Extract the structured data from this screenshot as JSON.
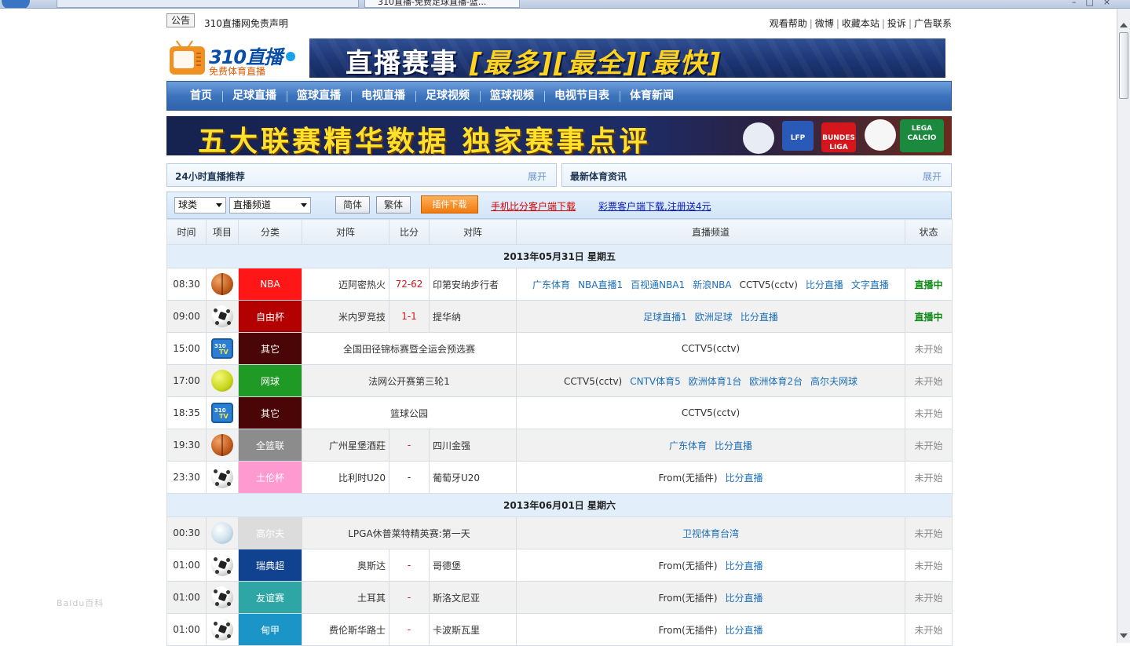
{
  "browser": {
    "tab_title": "310直播-免费足球直播-篮..."
  },
  "topbar": {
    "badge": "公告",
    "notice": "310直播网免责声明",
    "links": [
      "观看帮助",
      "微博",
      "收藏本站",
      "投诉",
      "广告联系"
    ]
  },
  "logo": {
    "title": "310直播",
    "subtitle": "免费体育直播"
  },
  "banner1": {
    "part1": "直播赛事",
    "part2": "[最多][最全][最快]"
  },
  "nav": {
    "items": [
      "首页",
      "足球直播",
      "篮球直播",
      "电视直播",
      "足球视频",
      "篮球视频",
      "电视节目表",
      "体育新闻"
    ]
  },
  "banner2": {
    "text": "五大联赛精华数据 独家赛事点评",
    "logos": [
      "LFP",
      "BUNDES LIGA",
      "LEGA CALCIO"
    ]
  },
  "panels": {
    "left_title": "24小时直播推荐",
    "left_more": "展开",
    "right_title": "最新体育资讯",
    "right_more": "展开"
  },
  "filters": {
    "sport_select": "球类",
    "channel_select": "直播频道",
    "btn_simplified": "简体",
    "btn_traditional": "繁体",
    "btn_plugin": "插件下载",
    "link_mobile": "手机比分客户端下载",
    "link_lottery": "彩票客户端下载,注册送4元"
  },
  "table": {
    "headers": [
      "时间",
      "项目",
      "分类",
      "对阵",
      "比分",
      "对阵",
      "直播频道",
      "状态"
    ],
    "date1": "2013年05月31日 星期五",
    "date2": "2013年06月01日 星期六",
    "colors": {
      "nba": "#ff1717",
      "freedom_cup": "#b30000",
      "other": "#4a0606",
      "tennis": "#1f9b25",
      "cba": "#8c8c8c",
      "toulon": "#ff9ad0",
      "golf": "#dcdcdc",
      "sweden": "#10428f",
      "friendly": "#2fa6a6",
      "portugal": "#1b95c8"
    },
    "rows_day1": [
      {
        "time": "08:30",
        "icon": "basketball-icon",
        "category": "NBA",
        "home": "迈阿密热火",
        "score": "72-62",
        "away": "印第安纳步行者",
        "match": "",
        "channels": [
          "广东体育",
          "NBA直播1",
          "百视通NBA1",
          "新浪NBA",
          "CCTV5(cctv)",
          "比分直播",
          "文字直播"
        ],
        "status": "直播中"
      },
      {
        "time": "09:00",
        "icon": "soccer-icon",
        "category": "自由杯",
        "home": "米内罗竞技",
        "score": "1-1",
        "away": "提华纳",
        "match": "",
        "channels": [
          "足球直播1",
          "欧洲足球",
          "比分直播"
        ],
        "status": "直播中"
      },
      {
        "time": "15:00",
        "icon": "tv-icon",
        "category": "其它",
        "home": "",
        "score": "",
        "away": "",
        "match": "全国田径锦标赛暨全运会预选赛",
        "channels": [
          "CCTV5(cctv)"
        ],
        "status": "未开始"
      },
      {
        "time": "17:00",
        "icon": "tennis-icon",
        "category": "网球",
        "home": "",
        "score": "",
        "away": "",
        "match": "法网公开赛第三轮1",
        "channels": [
          "CCTV5(cctv)",
          "CNTV体育5",
          "欧洲体育1台",
          "欧洲体育2台",
          "高尔夫网球"
        ],
        "status": "未开始"
      },
      {
        "time": "18:35",
        "icon": "tv-icon",
        "category": "其它",
        "home": "",
        "score": "",
        "away": "",
        "match": "篮球公园",
        "channels": [
          "CCTV5(cctv)"
        ],
        "status": "未开始"
      },
      {
        "time": "19:30",
        "icon": "basketball-icon",
        "category": "全篮联",
        "home": "广州星堡酒莊",
        "score": "-",
        "away": "四川金强",
        "match": "",
        "channels": [
          "广东体育",
          "比分直播"
        ],
        "status": "未开始"
      },
      {
        "time": "23:30",
        "icon": "soccer-icon",
        "category": "土伦杯",
        "home": "比利时U20",
        "score": "-",
        "away": "葡萄牙U20",
        "match": "",
        "channels": [
          "From(无插件)",
          "比分直播"
        ],
        "status": "未开始"
      }
    ],
    "rows_day2": [
      {
        "time": "00:30",
        "icon": "golf-icon",
        "category": "高尔夫",
        "home": "",
        "score": "",
        "away": "",
        "match": "LPGA休普莱特精英赛:第一天",
        "channels": [
          "卫视体育台湾"
        ],
        "status": "未开始"
      },
      {
        "time": "01:00",
        "icon": "soccer-icon",
        "category": "瑞典超",
        "home": "奥斯达",
        "score": "-",
        "away": "哥德堡",
        "match": "",
        "channels": [
          "From(无插件)",
          "比分直播"
        ],
        "status": "未开始"
      },
      {
        "time": "01:00",
        "icon": "soccer-icon",
        "category": "友谊赛",
        "home": "土耳其",
        "score": "-",
        "away": "斯洛文尼亚",
        "match": "",
        "channels": [
          "From(无插件)",
          "比分直播"
        ],
        "status": "未开始"
      },
      {
        "time": "01:00",
        "icon": "soccer-icon",
        "category": "甸甲",
        "home": "费伦斯华路士",
        "score": "-",
        "away": "卡波斯瓦里",
        "match": "",
        "channels": [
          "From(无插件)",
          "比分直播"
        ],
        "status": "未开始"
      }
    ]
  },
  "watermark": "Baidu百科"
}
